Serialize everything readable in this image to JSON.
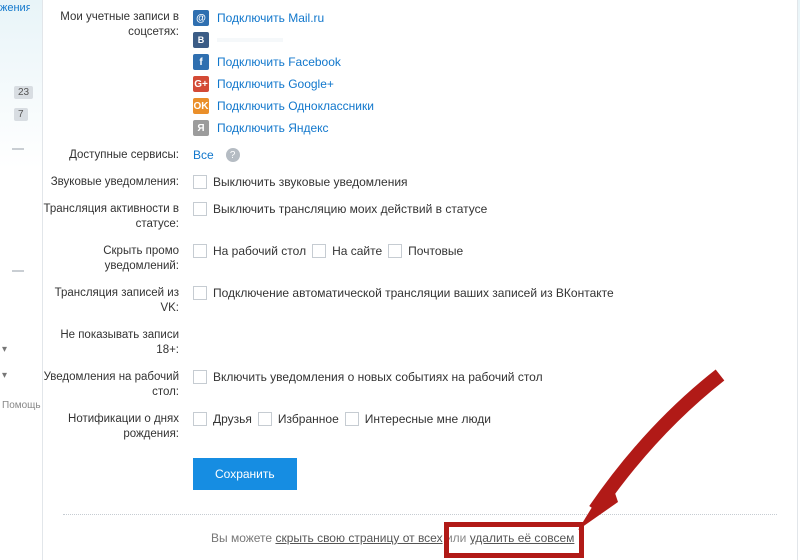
{
  "side": {
    "nav_truncated": "жения",
    "badge1": "23",
    "badge2": "7",
    "help": "Помощь"
  },
  "labels": {
    "accounts": "Мои учетные записи в соцсетях:",
    "services": "Доступные сервисы:",
    "sound": "Звуковые уведомления:",
    "activity": "Трансляция активности в статусе:",
    "promo": "Скрыть промо уведомлений:",
    "vk": "Трансляция записей из VK:",
    "adult": "Не показывать записи 18+:",
    "desktop": "Уведомления на рабочий стол:",
    "birthdays": "Нотификации о днях рождения:"
  },
  "social": {
    "mail": "Подключить Mail.ru",
    "vk": " ",
    "fb": "Подключить Facebook",
    "gp": "Подключить Google+",
    "ok": "Подключить Одноклассники",
    "ya": "Подключить Яндекс"
  },
  "services": {
    "all": "Все"
  },
  "checks": {
    "sound": "Выключить звуковые уведомления",
    "activity": "Выключить трансляцию моих действий в статусе",
    "promo1": "На рабочий стол",
    "promo2": "На сайте",
    "promo3": "Почтовые",
    "vk": "Подключение автоматической трансляции ваших записей из ВКонтакте",
    "desktop": "Включить уведомления о новых событиях на рабочий стол",
    "bday1": "Друзья",
    "bday2": "Избранное",
    "bday3": "Интересные мне люди"
  },
  "buttons": {
    "save": "Сохранить"
  },
  "footer": {
    "prefix": "Вы можете ",
    "hide": "скрыть свою страницу от всех",
    "join": " или ",
    "delete": "удалить её совсем"
  }
}
